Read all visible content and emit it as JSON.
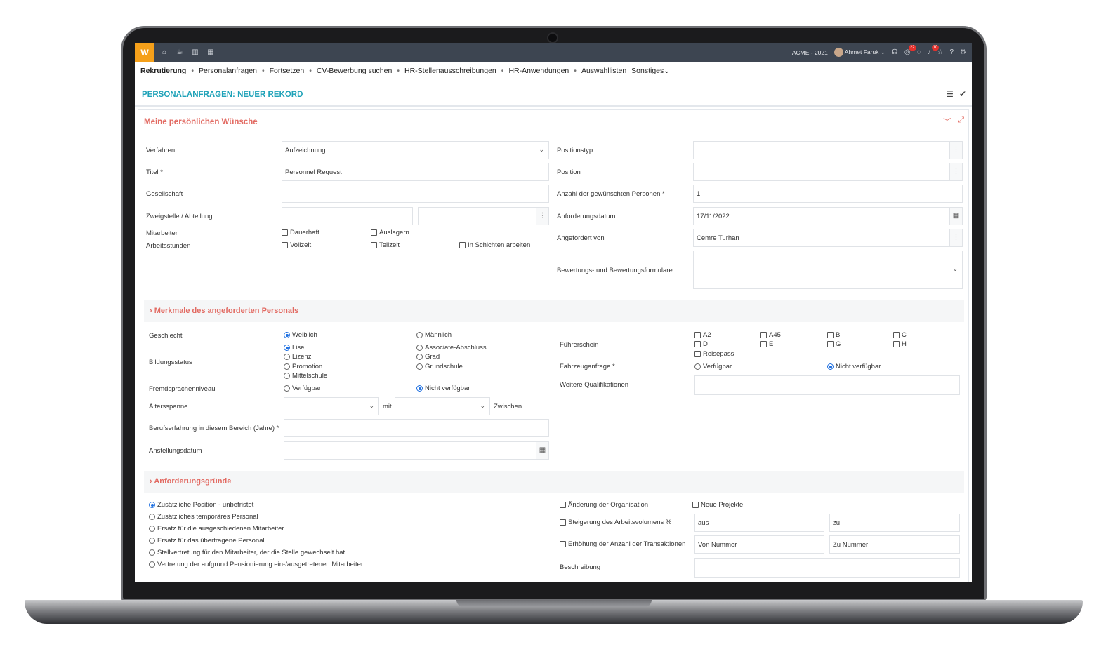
{
  "topbar": {
    "logo": "W",
    "company": "ACME - 2021",
    "user": "Ahmet Faruk",
    "badge_messages": "22",
    "badge_notifications": "10"
  },
  "nav": {
    "items": [
      "Rekrutierung",
      "Personalanfragen",
      "Fortsetzen",
      "CV-Bewerbung suchen",
      "HR-Stellenausschreibungen",
      "HR-Anwendungen",
      "Auswahllisten",
      "Sonstiges"
    ]
  },
  "page": {
    "title": "PERSONALANFRAGEN: NEUER REKORD"
  },
  "panel": {
    "title": "Meine persönlichen Wünsche"
  },
  "form": {
    "verfahren_label": "Verfahren",
    "verfahren_value": "Aufzeichnung",
    "titel_label": "Titel *",
    "titel_value": "Personnel Request",
    "gesellschaft_label": "Gesellschaft",
    "zweigstelle_label": "Zweigstelle / Abteilung",
    "mitarbeiter_label": "Mitarbeiter",
    "arbeitsstunden_label": "Arbeitsstunden",
    "dauerhaft": "Dauerhaft",
    "auslagern": "Auslagern",
    "vollzeit": "Vollzeit",
    "teilzeit": "Teilzeit",
    "schichten": "In Schichten arbeiten",
    "positionstyp_label": "Positionstyp",
    "position_label": "Position",
    "anzahl_label": "Anzahl der gewünschten Personen *",
    "anzahl_value": "1",
    "anforderungsdatum_label": "Anforderungsdatum",
    "anforderungsdatum_value": "17/11/2022",
    "angefordert_label": "Angefordert von",
    "angefordert_value": "Cemre Turhan",
    "bewertung_label": "Bewertungs- und Bewertungsformulare"
  },
  "merkmale": {
    "title": "Merkmale des angeforderten Personals",
    "geschlecht_label": "Geschlecht",
    "weiblich": "Weiblich",
    "maennlich": "Männlich",
    "bildung_label": "Bildungsstatus",
    "lise": "Lise",
    "lizenz": "Lizenz",
    "promotion": "Promotion",
    "mittelschule": "Mittelschule",
    "associate": "Associate-Abschluss",
    "grad": "Grad",
    "grundschule": "Grundschule",
    "fremd_label": "Fremdsprachenniveau",
    "verfuegbar": "Verfügbar",
    "nicht_verfuegbar": "Nicht verfügbar",
    "alter_label": "Altersspanne",
    "mit": "mit",
    "zwischen": "Zwischen",
    "erfahrung_label": "Berufserfahrung in diesem Bereich (Jahre) *",
    "anstellung_label": "Anstellungsdatum",
    "fuehrerschein_label": "Führerschein",
    "lic_a2": "A2",
    "lic_a45": "A45",
    "lic_b": "B",
    "lic_c": "C",
    "lic_d": "D",
    "lic_e": "E",
    "lic_g": "G",
    "lic_h": "H",
    "lic_reisepass": "Reisepass",
    "fahrzeug_label": "Fahrzeuganfrage *",
    "weitere_label": "Weitere Qualifikationen"
  },
  "gruende": {
    "title": "Anforderungsgründe",
    "r1": "Zusätzliche Position - unbefristet",
    "r2": "Zusätzliches temporäres Personal",
    "r3": "Ersatz für die ausgeschiedenen Mitarbeiter",
    "r4": "Ersatz für das übertragene Personal",
    "r5": "Stellvertretung für den Mitarbeiter, der die Stelle gewechselt hat",
    "r6": "Vertretung der aufgrund Pensionierung ein-/ausgetretenen Mitarbeiter.",
    "aenderung": "Änderung der Organisation",
    "projekte": "Neue Projekte",
    "steigerung": "Steigerung des Arbeitsvolumens %",
    "aus": "aus",
    "zu": "zu",
    "erhoehung": "Erhöhung der Anzahl der Transaktionen",
    "von_nummer": "Von Nummer",
    "zu_nummer": "Zu Nummer",
    "beschreibung_label": "Beschreibung"
  }
}
